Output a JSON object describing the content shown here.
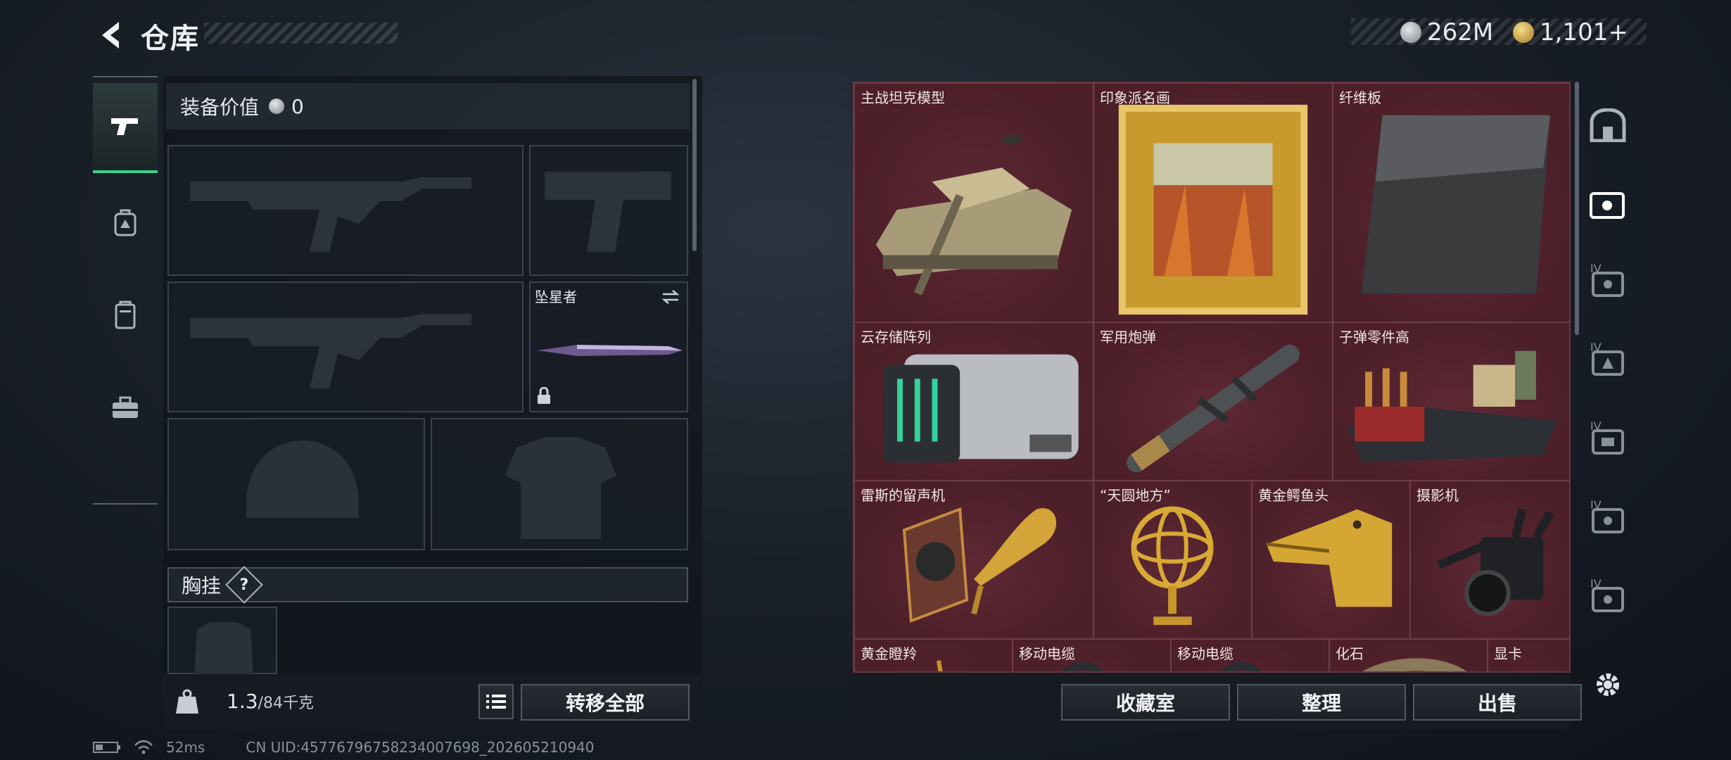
{
  "header": {
    "title": "仓库"
  },
  "currency": {
    "silver": "262M",
    "gold": "1,101+"
  },
  "equipment": {
    "value_label": "装备价值",
    "value": "0",
    "melee_name": "坠星者",
    "chest_rig_label": "胸挂",
    "help_glyph": "?"
  },
  "weight": {
    "current": "1.3",
    "max": "/84千克"
  },
  "buttons": {
    "transfer_all": "转移全部",
    "collection_room": "收藏室",
    "organize": "整理",
    "sell": "出售"
  },
  "storage": {
    "items": [
      {
        "name": "主战坦克模型",
        "icon": "tank-icon"
      },
      {
        "name": "印象派名画",
        "icon": "painting-icon"
      },
      {
        "name": "纤维板",
        "icon": "fiberboard-icon"
      },
      {
        "name": "云存储阵列",
        "icon": "server-icon"
      },
      {
        "name": "军用炮弹",
        "icon": "missile-icon"
      },
      {
        "name": "子弹零件高",
        "icon": "ammo-parts-icon"
      },
      {
        "name": "雷斯的留声机",
        "icon": "gramophone-icon"
      },
      {
        "name": "“天圆地方”",
        "icon": "armillary-icon"
      },
      {
        "name": "黄金鳄鱼头",
        "icon": "gold-croc-icon"
      },
      {
        "name": "摄影机",
        "icon": "camera-icon"
      },
      {
        "name": "黄金瞪羚",
        "icon": "gazelle-icon"
      },
      {
        "name": "移动电缆",
        "icon": "cable-icon"
      },
      {
        "name": "移动电缆",
        "icon": "cable-icon"
      },
      {
        "name": "化石",
        "icon": "fossil-icon"
      },
      {
        "name": "显卡",
        "icon": "gpu-icon"
      }
    ]
  },
  "rail_labels": [
    "IV",
    "IV",
    "IV",
    "IV",
    "IV"
  ],
  "status": {
    "ping": "52ms",
    "uid": "CN UID:457767967582340076​98_202605210940"
  },
  "colors": {
    "accent_green": "#39d28f",
    "storage_bg": "#4a1f28",
    "cell_border": "#6e3f49"
  }
}
